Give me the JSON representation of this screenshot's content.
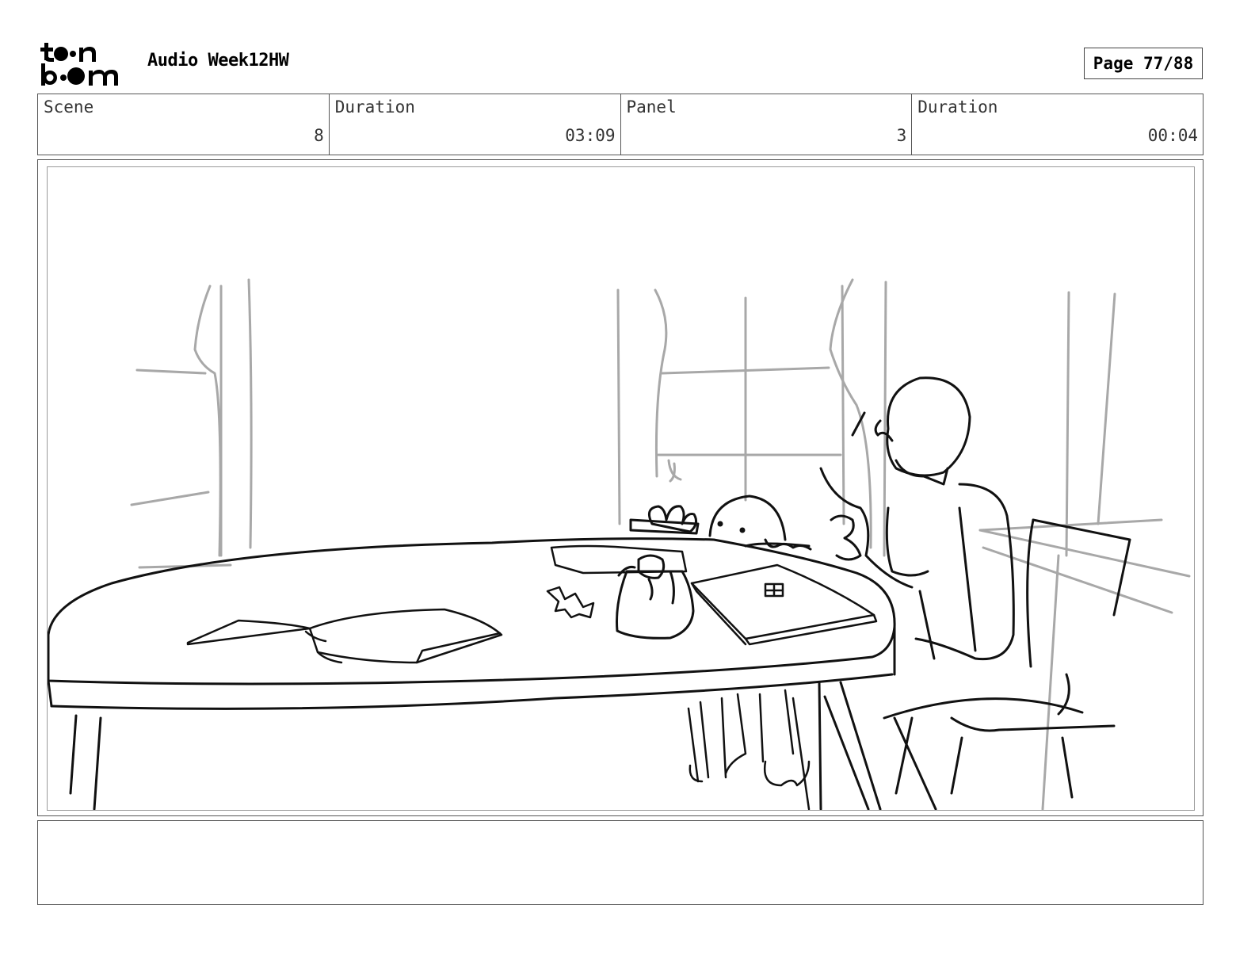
{
  "header": {
    "logo_text": "toon boom",
    "title": "Audio Week12HW",
    "page_label": "Page 77/88"
  },
  "info": [
    {
      "label": "Scene",
      "value": "8"
    },
    {
      "label": "Duration",
      "value": "03:09"
    },
    {
      "label": "Panel",
      "value": "3"
    },
    {
      "label": "Duration",
      "value": "00:04"
    }
  ],
  "panel": {
    "image": "storyboard-sketch"
  },
  "notes": {
    "text": ""
  }
}
